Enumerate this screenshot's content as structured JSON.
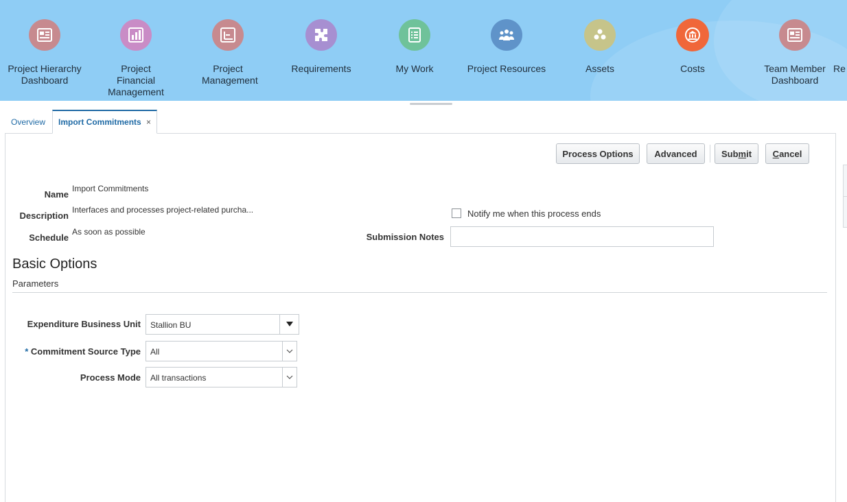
{
  "springboard": {
    "items": [
      {
        "label": "Project Hierarchy Dashboard",
        "icon": "dashboard-icon",
        "color": "#c78a8f"
      },
      {
        "label": "Project Financial Management",
        "icon": "bar-chart-icon",
        "color": "#c98cc6"
      },
      {
        "label": "Project Management",
        "icon": "gantt-icon",
        "color": "#c78a8f"
      },
      {
        "label": "Requirements",
        "icon": "puzzle-icon",
        "color": "#a78fd1"
      },
      {
        "label": "My Work",
        "icon": "checklist-icon",
        "color": "#6fc29a"
      },
      {
        "label": "Project Resources",
        "icon": "people-icon",
        "color": "#5f93c9"
      },
      {
        "label": "Assets",
        "icon": "dots-icon",
        "color": "#c6c48a"
      },
      {
        "label": "Costs",
        "icon": "bank-icon",
        "color": "#f0673a"
      },
      {
        "label": "Team Member Dashboard",
        "icon": "dashboard-icon",
        "color": "#c78a8f"
      },
      {
        "label": "Re",
        "icon": "",
        "color": ""
      }
    ]
  },
  "tabs": {
    "overview": "Overview",
    "active": "Import Commitments",
    "close": "×"
  },
  "toolbar": {
    "process_options": "Process Options",
    "advanced": "Advanced",
    "submit_pre": "Sub",
    "submit_key": "m",
    "submit_post": "it",
    "cancel_key": "C",
    "cancel_post": "ancel"
  },
  "process": {
    "name_label": "Name",
    "name_value": "Import Commitments",
    "description_label": "Description",
    "description_value": "Interfaces and processes project-related purcha...",
    "schedule_label": "Schedule",
    "schedule_value": "As soon as possible",
    "notify_label": "Notify me when this process ends",
    "notes_label": "Submission Notes",
    "notes_value": ""
  },
  "basic_options": {
    "title": "Basic Options",
    "subtitle": "Parameters",
    "fields": [
      {
        "label": "Expenditure Business Unit",
        "value": "Stallion BU",
        "required": false
      },
      {
        "label": "Commitment Source Type",
        "value": "All",
        "required": true
      },
      {
        "label": "Process Mode",
        "value": "All transactions",
        "required": false
      }
    ],
    "required_marker": "*"
  },
  "colors": {
    "band": "#8fcdf5",
    "link": "#1f6aa5",
    "costs_active": "#f0673a"
  }
}
